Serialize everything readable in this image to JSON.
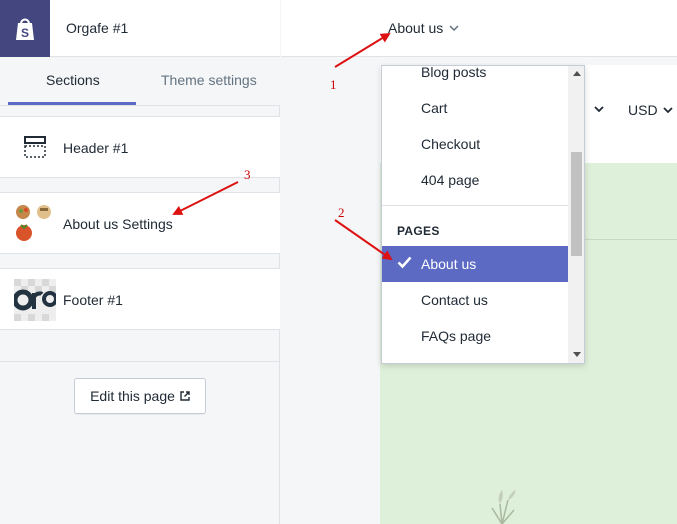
{
  "sidebar": {
    "theme_name": "Orgafe #1",
    "tabs": [
      {
        "label": "Sections",
        "active": true
      },
      {
        "label": "Theme settings",
        "active": false
      }
    ],
    "sections": [
      {
        "label": "Header #1",
        "icon": "header-layout-icon"
      },
      {
        "label": "About us Settings",
        "icon": "emoji-thumbnail-icon"
      },
      {
        "label": "Footer #1",
        "icon": "orgafe-logo-thumbnail-icon"
      }
    ],
    "edit_button": "Edit this page"
  },
  "preview": {
    "page_selector": "About us",
    "currency": "USD"
  },
  "dropdown": {
    "items_top": [
      "Blog posts",
      "Cart",
      "Checkout",
      "404 page"
    ],
    "group_heading": "PAGES",
    "selected": "About us",
    "items_bottom": [
      "Contact us",
      "FAQs page"
    ]
  },
  "annotations": [
    "1",
    "2",
    "3"
  ],
  "colors": {
    "brand": "#43467f",
    "accent": "#5c6ac4",
    "annotation": "#cc0000",
    "preview_bg": "#dff0da"
  }
}
